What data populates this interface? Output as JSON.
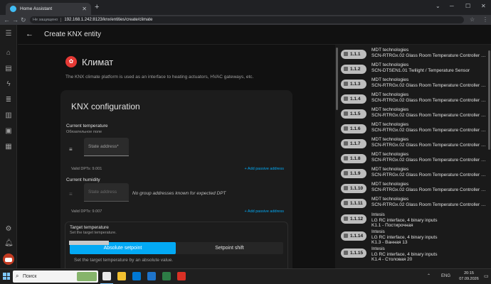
{
  "browser": {
    "tab_title": "Home Assistant",
    "security_label": "Не защищено",
    "url": "192.168.1.242:8123/knx/entities/create/climate"
  },
  "toolbar": {
    "title": "Create KNX entity"
  },
  "platform": {
    "title": "Климат",
    "description": "The KNX climate platform is used as an interface to heating actuators, HVAC gateways, etc."
  },
  "config": {
    "title": "KNX configuration",
    "current_temperature": {
      "title": "Current temperature",
      "required": "Обязательное поле",
      "field_placeholder": "State address*",
      "dpts": "Valid DPTs: 9.001",
      "add_passive": "+ Add passive address"
    },
    "current_humidity": {
      "title": "Current humidity",
      "field_placeholder": "State address",
      "no_ga": "No group addresses known for expected DPT",
      "dpts": "Valid DPTs: 9.007",
      "add_passive": "+ Add passive address"
    },
    "target_temperature": {
      "title": "Target temperature",
      "subtitle": "Set the target temperature.",
      "tab_absolute": "Absolute setpoint",
      "tab_shift": "Setpoint shift",
      "description": "Set the target temperature by an absolute value."
    }
  },
  "group_addresses": [
    {
      "address": "1.1.1",
      "line1": "MDT technologies",
      "line2": "SCN-RTRGx.02 Glass Room Temperature Controller Smart ..."
    },
    {
      "address": "1.1.2",
      "line1": "MDT technologies",
      "line2": "SCN-DTSEN1.01 Twilight / Temperature Sensor"
    },
    {
      "address": "1.1.3",
      "line1": "MDT technologies",
      "line2": "SCN-RTRGx.02 Glass Room Temperature Controller Smart ..."
    },
    {
      "address": "1.1.4",
      "line1": "MDT technologies",
      "line2": "SCN-RTRGx.02 Glass Room Temperature Controller Smart ..."
    },
    {
      "address": "1.1.5",
      "line1": "MDT technologies",
      "line2": "SCN-RTRGx.02 Glass Room Temperature Controller Smart ..."
    },
    {
      "address": "1.1.6",
      "line1": "MDT technologies",
      "line2": "SCN-RTRGx.02 Glass Room Temperature Controller Smart ..."
    },
    {
      "address": "1.1.7",
      "line1": "MDT technologies",
      "line2": "SCN-RTRGx.02 Glass Room Temperature Controller Smart ..."
    },
    {
      "address": "1.1.8",
      "line1": "MDT technologies",
      "line2": "SCN-RTRGx.02 Glass Room Temperature Controller Smart ..."
    },
    {
      "address": "1.1.9",
      "line1": "MDT technologies",
      "line2": "SCN-RTRGx.02 Glass Room Temperature Controller Smart ..."
    },
    {
      "address": "1.1.10",
      "line1": "MDT technologies",
      "line2": "SCN-RTRGx.02 Glass Room Temperature Controller Smart ..."
    },
    {
      "address": "1.1.11",
      "line1": "MDT technologies",
      "line2": "SCN-RTRGx.02 Glass Room Temperature Controller Smart ..."
    },
    {
      "address": "1.1.12",
      "line1": "Intesis",
      "line2": "LG RC interface, 4 binary inputs",
      "line3": "K1.1 - Постирочная"
    },
    {
      "address": "1.1.14",
      "line1": "Intesis",
      "line2": "LG RC interface, 4 binary inputs",
      "line3": "K1.3 - Ванная 13"
    },
    {
      "address": "1.1.15",
      "line1": "Intesis",
      "line2": "LG RC interface, 4 binary inputs",
      "line3": "K1.4 - Столовая 20"
    }
  ],
  "taskbar": {
    "search_placeholder": "Поиск",
    "lang": "ENG",
    "time": "20:15",
    "date": "07.09.2026"
  },
  "colors": {
    "accent": "#03a9f4",
    "platform_badge": "#e53935",
    "background": "#111111"
  }
}
